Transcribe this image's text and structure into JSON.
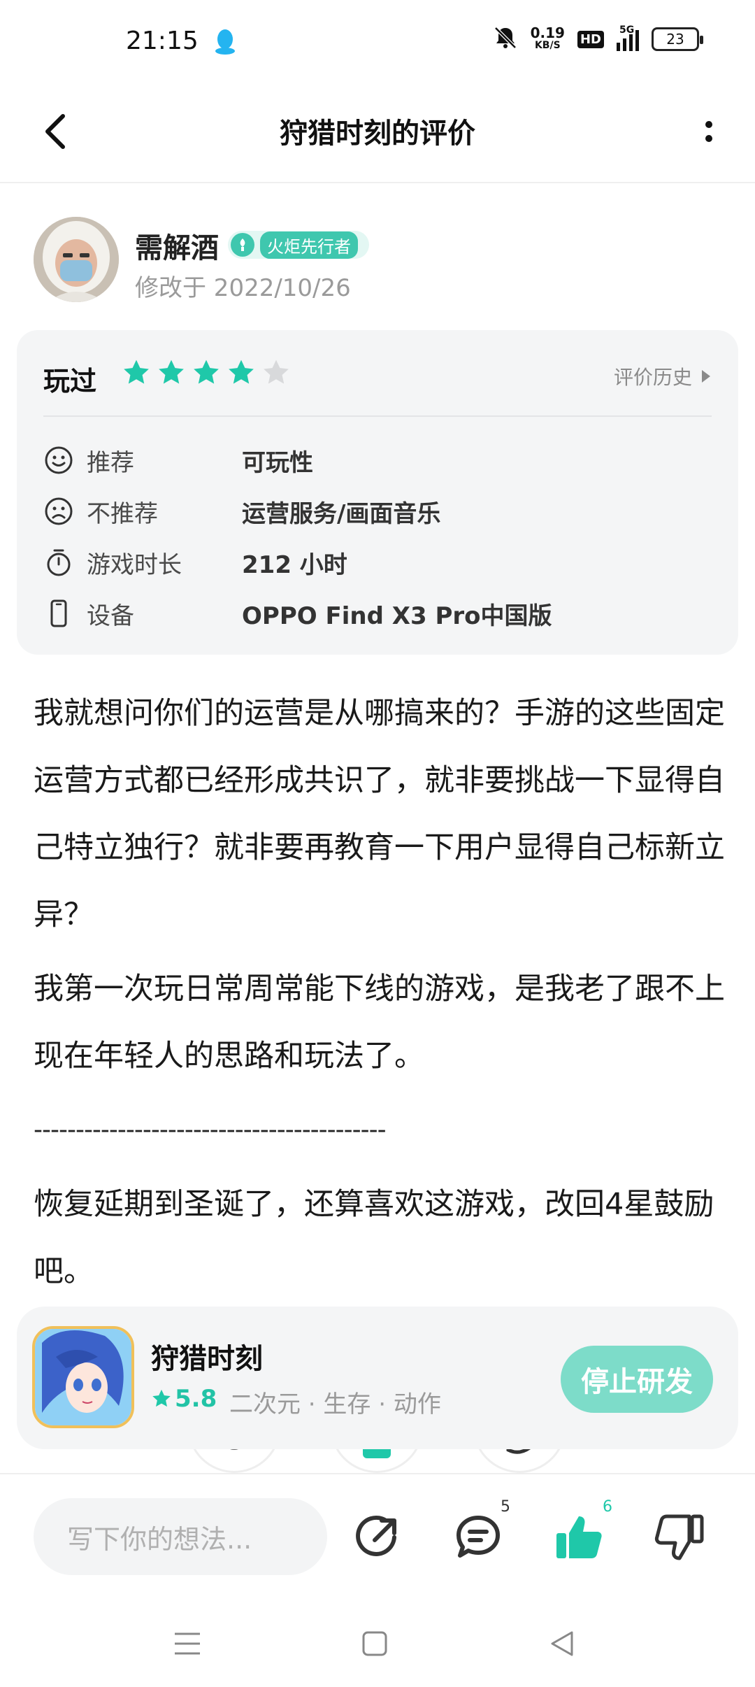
{
  "status_bar": {
    "time": "21:15",
    "net_speed_value": "0.19",
    "net_speed_unit": "KB/S",
    "hd": "HD",
    "network": "5G",
    "battery": "23",
    "icons": [
      "qq-icon",
      "mute-bell-icon",
      "signal-icon",
      "battery-icon"
    ]
  },
  "header": {
    "title": "狩猎时刻的评价",
    "back_icon": "back-arrow-icon",
    "more_icon": "more-vertical-icon"
  },
  "author": {
    "name": "需解酒",
    "badge": "火炬先行者",
    "date": "修改于 2022/10/26"
  },
  "review_card": {
    "played_label": "玩过",
    "rating": 4,
    "rating_max": 5,
    "history_label": "评价历史",
    "rows": [
      {
        "icon": "smile-icon",
        "label": "推荐",
        "value": "可玩性"
      },
      {
        "icon": "frown-icon",
        "label": "不推荐",
        "value": "运营服务/画面音乐"
      },
      {
        "icon": "stopwatch-icon",
        "label": "游戏时长",
        "value": "212 小时"
      },
      {
        "icon": "phone-icon",
        "label": "设备",
        "value": "OPPO Find X3 Pro中国版"
      }
    ]
  },
  "content": {
    "para1": "我就想问你们的运营是从哪搞来的？手游的这些固定运营方式都已经形成共识了，就非要挑战一下显得自己特立独行？就非要再教育一下用户显得自己标新立异？",
    "para2": "我第一次玩日常周常能下线的游戏，是我老了跟不上现在年轻人的思路和玩法了。",
    "separator": "------------------------------------------",
    "para3": "恢复延期到圣诞了，还算喜欢这游戏，改回4星鼓励吧。"
  },
  "game": {
    "name": "狩猎时刻",
    "score": "5.8",
    "tags": "二次元 · 生存 · 动作",
    "status_button": "停止研发"
  },
  "bottom_bar": {
    "comment_placeholder": "写下你的想法...",
    "comment_count": "5",
    "like_count": "6",
    "accent_color": "#1fc8a9"
  }
}
